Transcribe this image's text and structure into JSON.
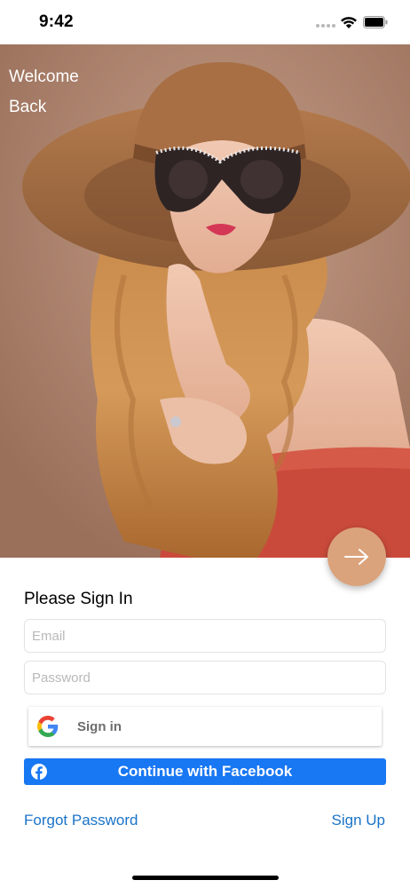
{
  "status_bar": {
    "time": "9:42"
  },
  "hero": {
    "welcome_line1": "Welcome",
    "welcome_line2": "Back",
    "next_icon": "arrow-right-icon"
  },
  "form": {
    "title": "Please Sign In",
    "email_placeholder": "Email",
    "email_value": "",
    "password_placeholder": "Password",
    "password_value": "",
    "google_label": "Sign in",
    "facebook_label": "Continue with Facebook",
    "forgot_label": "Forgot Password",
    "signup_label": "Sign Up"
  },
  "colors": {
    "accent": "#dba37c",
    "facebook": "#1877f2",
    "link": "#1a73c8"
  }
}
